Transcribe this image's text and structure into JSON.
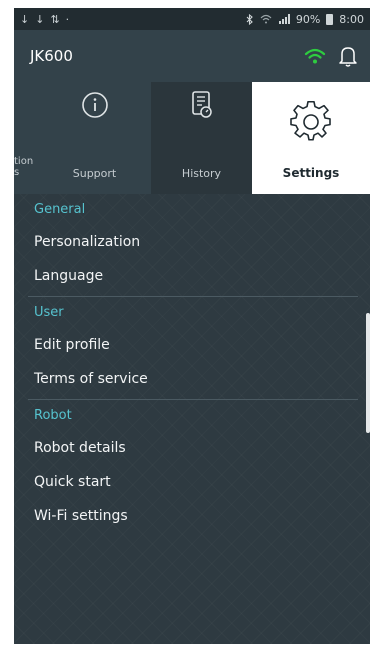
{
  "status": {
    "left_glyphs": [
      "↓",
      "↓",
      "⇅",
      "·"
    ],
    "battery": "90%",
    "time": "8:00"
  },
  "appbar": {
    "title": "JK600",
    "wifi_color": "#2ecc40"
  },
  "tabs": {
    "partial_label": "tion\ns",
    "support": "Support",
    "history": "History",
    "settings": "Settings"
  },
  "menu": {
    "general": {
      "header": "General",
      "items": [
        "Personalization",
        "Language"
      ]
    },
    "user": {
      "header": "User",
      "items": [
        "Edit profile",
        "Terms of service"
      ]
    },
    "robot": {
      "header": "Robot",
      "items": [
        "Robot details",
        "Quick start",
        "Wi-Fi settings"
      ]
    }
  },
  "colors": {
    "section_header": "#56c3cf",
    "background": "#2e3a41",
    "active_tab": "#ffffff"
  }
}
